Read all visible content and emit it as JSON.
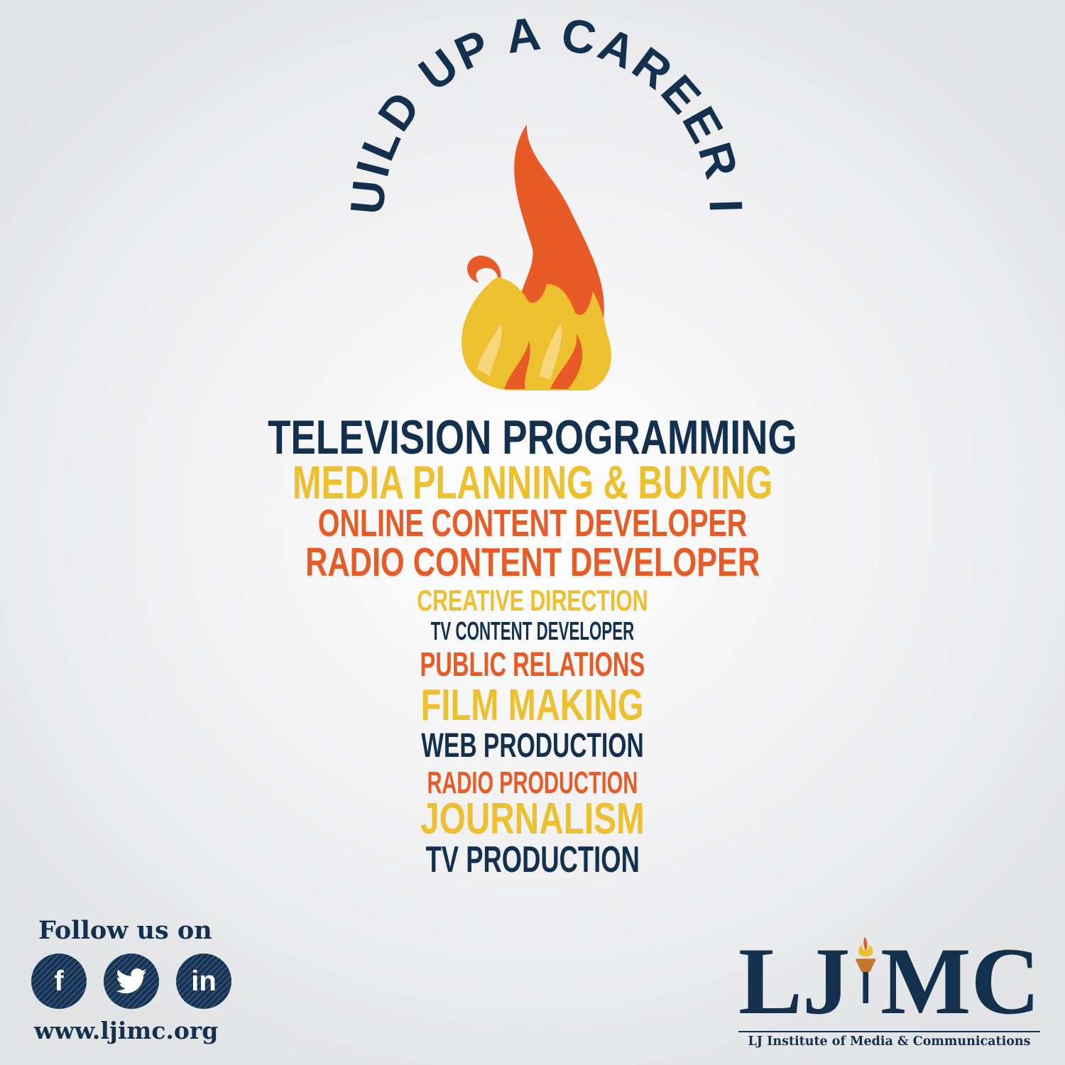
{
  "headline": "BUILD UP A CAREER IN",
  "careers": [
    {
      "label": "TELEVISION PROGRAMMING",
      "color": "navy"
    },
    {
      "label": "MEDIA PLANNING & BUYING",
      "color": "yellow"
    },
    {
      "label": "ONLINE CONTENT DEVELOPER",
      "color": "orange"
    },
    {
      "label": "RADIO CONTENT DEVELOPER",
      "color": "orange"
    },
    {
      "label": "CREATIVE DIRECTION",
      "color": "yellow"
    },
    {
      "label": "TV CONTENT DEVELOPER",
      "color": "navy"
    },
    {
      "label": "PUBLIC RELATIONS",
      "color": "orange"
    },
    {
      "label": "FILM MAKING",
      "color": "yellow"
    },
    {
      "label": "WEB PRODUCTION",
      "color": "navy"
    },
    {
      "label": "RADIO PRODUCTION",
      "color": "orange"
    },
    {
      "label": "JOURNALISM",
      "color": "yellow"
    },
    {
      "label": "TV PRODUCTION",
      "color": "navy"
    }
  ],
  "colors": {
    "navy": "#14304f",
    "yellow": "#ecc02f",
    "orange": "#e85a26",
    "flame_light": "#f7d77a"
  },
  "social": {
    "follow_label": "Follow us on",
    "icons": [
      {
        "name": "facebook-icon",
        "glyph": "f"
      },
      {
        "name": "twitter-icon",
        "glyph": "🐦"
      },
      {
        "name": "linkedin-icon",
        "glyph": "in"
      }
    ],
    "website": "www.ljimc.org"
  },
  "logo": {
    "left_letters": "LJ",
    "right_letters": "MC",
    "tagline": "LJ Institute of Media & Communications"
  }
}
